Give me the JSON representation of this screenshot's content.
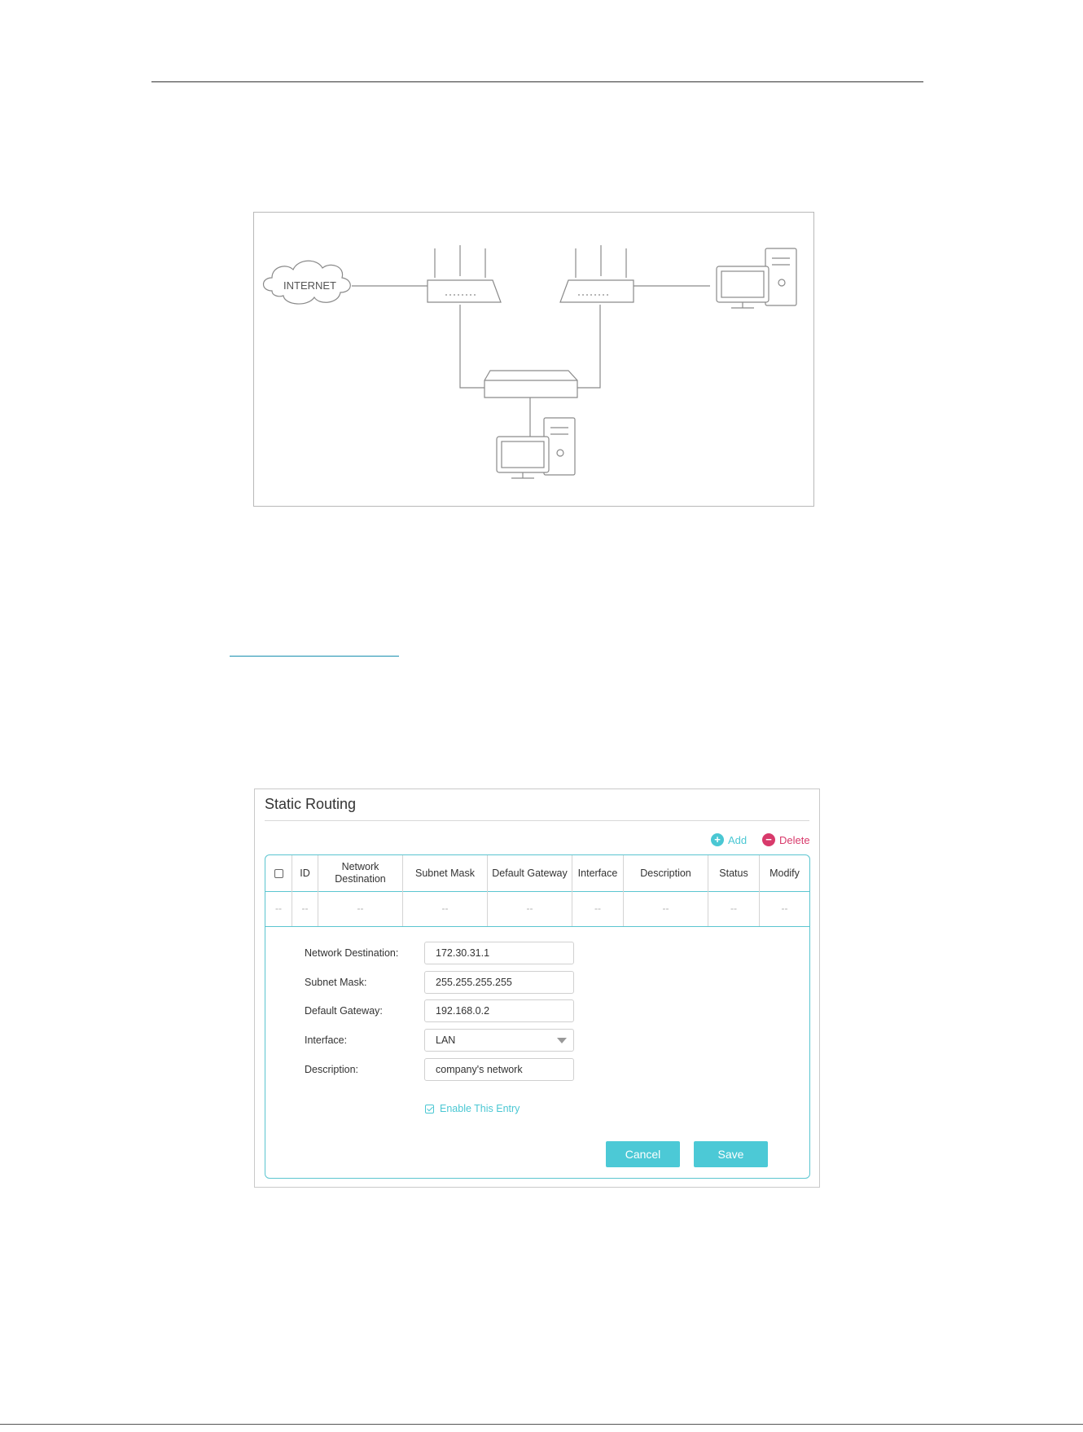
{
  "diagram": {
    "cloud_label": "INTERNET"
  },
  "panel": {
    "title": "Static Routing",
    "actions": {
      "add": "Add",
      "delete": "Delete"
    },
    "columns": [
      "ID",
      "Network Destination",
      "Subnet Mask",
      "Default Gateway",
      "Interface",
      "Description",
      "Status",
      "Modify"
    ],
    "empty_cell": "--",
    "form": {
      "network_destination_label": "Network Destination:",
      "network_destination_value": "172.30.31.1",
      "subnet_mask_label": "Subnet Mask:",
      "subnet_mask_value": "255.255.255.255",
      "default_gateway_label": "Default Gateway:",
      "default_gateway_value": "192.168.0.2",
      "interface_label": "Interface:",
      "interface_value": "LAN",
      "description_label": "Description:",
      "description_value": "company's network",
      "enable_label": "Enable This Entry",
      "enable_checked": true
    },
    "buttons": {
      "cancel": "Cancel",
      "save": "Save"
    }
  },
  "colors": {
    "accent": "#4cc9d6",
    "delete": "#d83a6b"
  }
}
